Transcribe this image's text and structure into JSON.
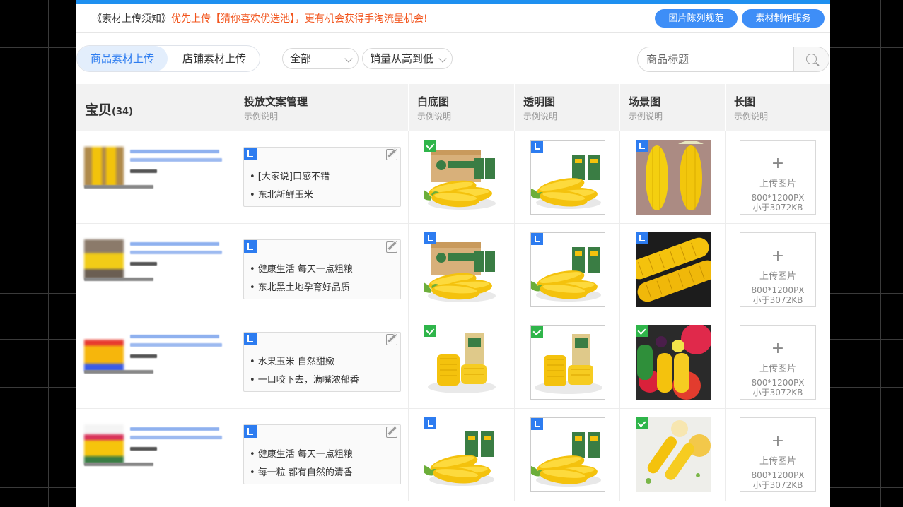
{
  "notice": {
    "part1": "《素材上传须知》",
    "part2": "优先上传【猜你喜欢优选池】，更有机会获得手淘流量机会!",
    "btn_rules": "图片陈列规范",
    "btn_service": "素材制作服务"
  },
  "tabs": {
    "product": "商品素材上传",
    "store": "店铺素材上传"
  },
  "filters": {
    "category": "全部",
    "sort": "销量从高到低"
  },
  "search": {
    "placeholder": "商品标题"
  },
  "table": {
    "col_item": "宝贝",
    "item_count": "(34)",
    "col_copy": "投放文案管理",
    "col_white": "白底图",
    "col_transparent": "透明图",
    "col_scene": "场景图",
    "col_long": "长图",
    "example": "示例说明"
  },
  "upload": {
    "plus": "+",
    "label": "上传图片",
    "size": "800*1200PX",
    "limit": "小于3072KB"
  },
  "rows": [
    {
      "bullet1": "• [大家说]口感不错",
      "bullet2": "• 东北新鲜玉米",
      "white_badge": "check",
      "transparent_badge": "corner",
      "scene_badge": "corner",
      "scene_type": "hands"
    },
    {
      "bullet1": "• 健康生活 每天一点粗粮",
      "bullet2": "• 东北黑土地孕育好品质",
      "white_badge": "corner",
      "transparent_badge": "corner",
      "scene_badge": "corner",
      "scene_type": "dark"
    },
    {
      "bullet1": "• 水果玉米 自然甜嫩",
      "bullet2": "• 一口咬下去，满嘴浓郁香",
      "white_badge": "check",
      "transparent_badge": "check",
      "scene_badge": "check",
      "scene_type": "fruits"
    },
    {
      "bullet1": "• 健康生活 每天一点粗粮",
      "bullet2": "• 每一粒 都有自然的清香",
      "white_badge": "corner",
      "transparent_badge": "corner",
      "scene_badge": "check",
      "scene_type": "table"
    }
  ]
}
